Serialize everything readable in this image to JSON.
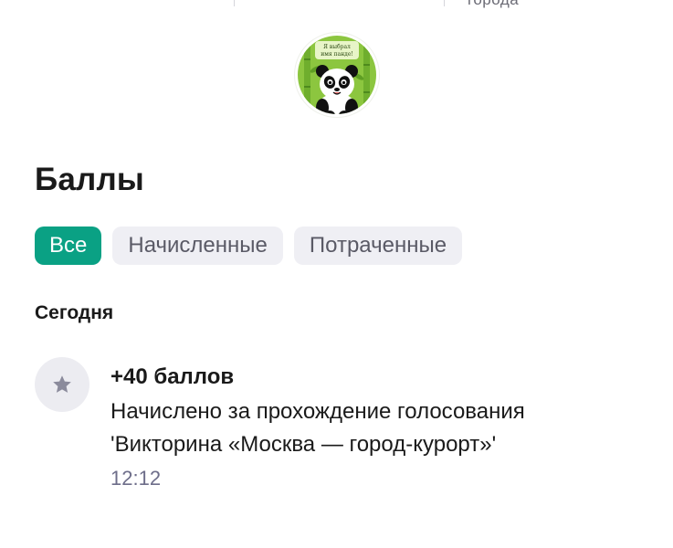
{
  "top": {
    "cut_text": "города"
  },
  "badge": {
    "text_line1": "Я выбрал",
    "text_line2": "имя панде!",
    "icon": "panda-badge-icon"
  },
  "section": {
    "title": "Баллы"
  },
  "filters": {
    "tabs": [
      {
        "label": "Все",
        "active": true
      },
      {
        "label": "Начисленные",
        "active": false
      },
      {
        "label": "Потраченные",
        "active": false
      }
    ]
  },
  "history": {
    "group_label": "Сегодня",
    "items": [
      {
        "icon": "star-icon",
        "amount": "+40 баллов",
        "desc_line1": "Начислено за прохождение голосования",
        "desc_line2": "'Викторина «Москва — город-курорт»'",
        "time": "12:12"
      }
    ]
  },
  "colors": {
    "accent": "#0aa184",
    "chip_bg": "#efeff4",
    "icon_bg": "#ececf1",
    "muted_time": "#6e6e8a"
  }
}
